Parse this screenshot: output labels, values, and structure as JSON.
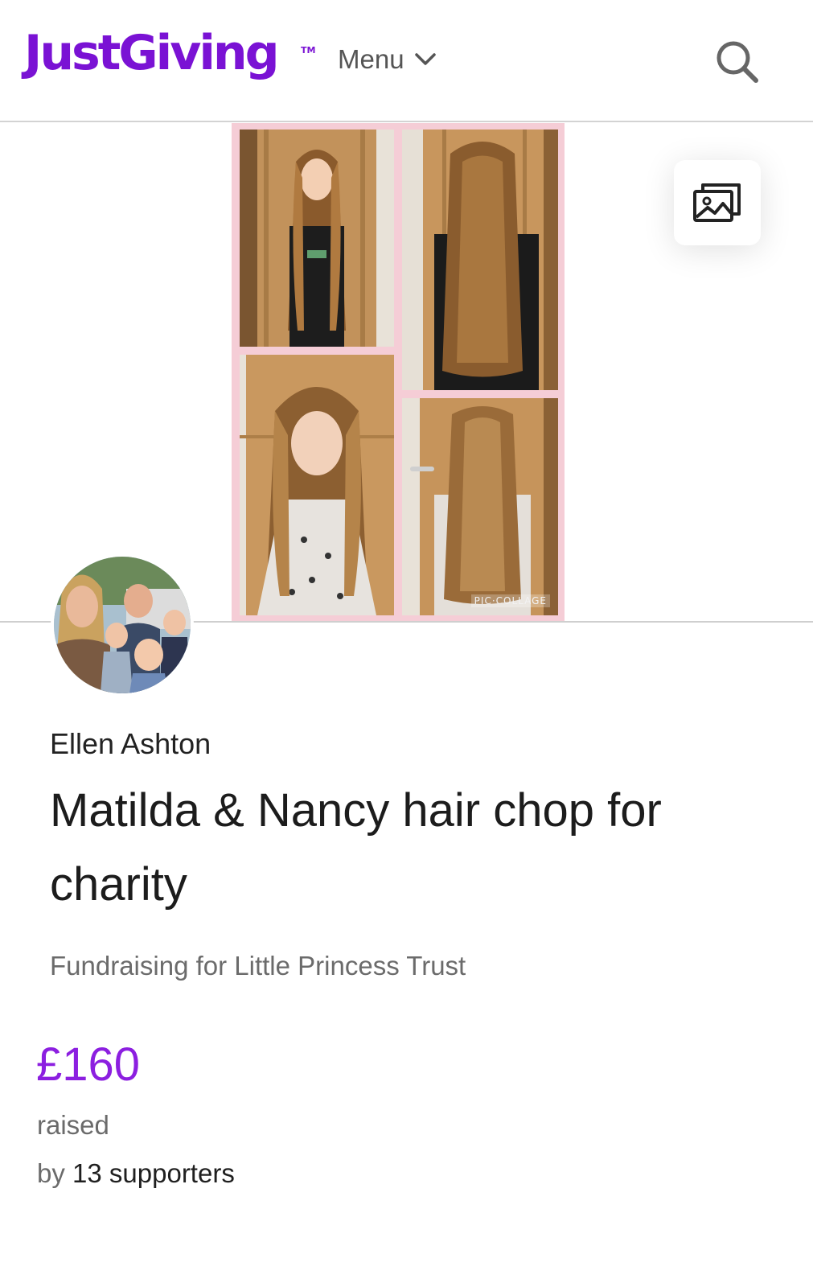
{
  "header": {
    "logo_text": "JustGiving",
    "logo_tm": "TM",
    "menu_label": "Menu",
    "brand_color": "#7a12d4"
  },
  "hero": {
    "watermark": "PIC·COLLAGE",
    "gallery_icon": "gallery-icon"
  },
  "page": {
    "owner_name": "Ellen Ashton",
    "title": "Matilda & Nancy hair chop for charity",
    "fundraising_prefix": "Fundraising for",
    "charity_name": "Little Princess Trust",
    "amount_raised": "£160",
    "raised_label": "raised",
    "by_label": "by",
    "supporters": "13 supporters",
    "accent_color": "#8c1fe0"
  }
}
